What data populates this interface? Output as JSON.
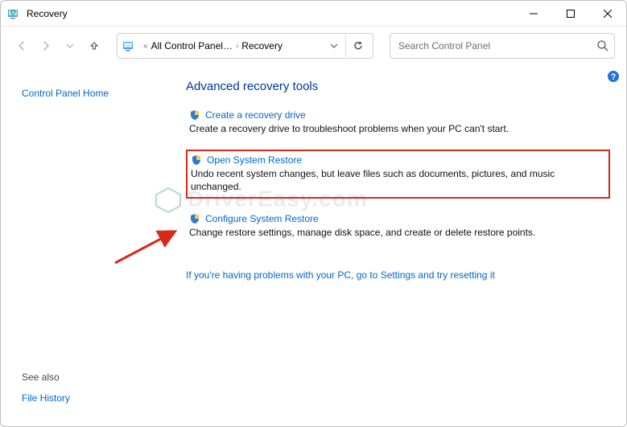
{
  "window": {
    "title": "Recovery"
  },
  "nav": {
    "breadcrumb_prefix": "«",
    "breadcrumb_seg1": "All Control Panel…",
    "breadcrumb_seg2": "Recovery",
    "search_placeholder": "Search Control Panel"
  },
  "sidebar": {
    "home_link": "Control Panel Home",
    "see_also_label": "See also",
    "file_history_link": "File History"
  },
  "main": {
    "heading": "Advanced recovery tools",
    "tools": [
      {
        "link": "Create a recovery drive",
        "desc": "Create a recovery drive to troubleshoot problems when your PC can't start."
      },
      {
        "link": "Open System Restore",
        "desc": "Undo recent system changes, but leave files such as documents, pictures, and music unchanged."
      },
      {
        "link": "Configure System Restore",
        "desc": "Change restore settings, manage disk space, and create or delete restore points."
      }
    ],
    "footer_link": "If you're having problems with your PC, go to Settings and try resetting it"
  },
  "watermark": "DriverEasy.com"
}
